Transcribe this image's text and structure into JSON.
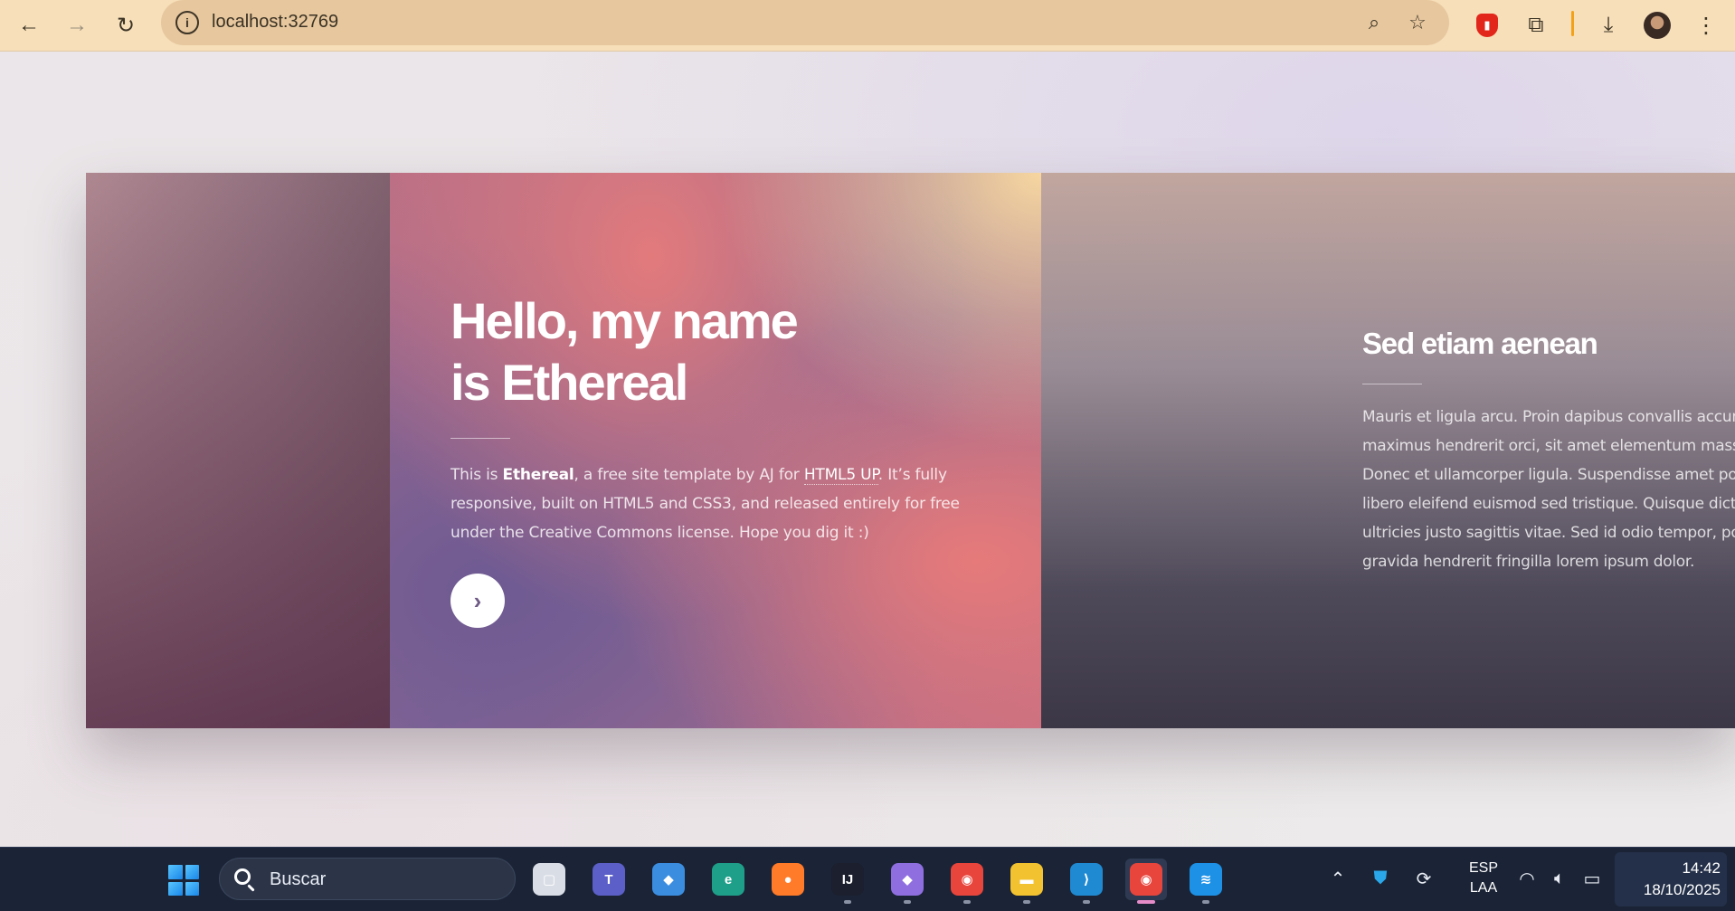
{
  "browser": {
    "url": "localhost:32769",
    "site_info_glyph": "i",
    "back_icon": "arrow-left-icon",
    "forward_icon": "arrow-right-icon",
    "reload_icon": "reload-icon",
    "zoom_icon": "zoom-out-icon",
    "bookmark_icon": "star-icon",
    "extensions": [
      "ublock-icon",
      "puzzle-icon"
    ],
    "download_icon": "download-icon",
    "menu_icon": "kebab-menu-icon"
  },
  "intro": {
    "title_line1": "Hello, my name",
    "title_line2": "is Ethereal",
    "text_prefix": "This is ",
    "text_brand": "Ethereal",
    "text_middle": ", a free site template by AJ for ",
    "text_link": "HTML5 UP",
    "text_suffix": ". It’s fully responsive, built on HTML5 and CSS3, and released entirely for free under the Creative Commons license. Hope you dig it :)",
    "next_glyph": "›"
  },
  "section": {
    "title": "Sed etiam aenean",
    "lines": [
      "Mauris et ligula arcu. Proin dapibus convallis accumsa",
      "maximus hendrerit orci, sit amet elementum massa h",
      "Donec et ullamcorper ligula. Suspendisse amet poten",
      "libero eleifend euismod sed tristique. Quisque dictum",
      "ultricies justo sagittis vitae. Sed id odio tempor, portti",
      "gravida hendrerit fringilla lorem ipsum dolor."
    ]
  },
  "taskbar": {
    "search_placeholder": "Buscar",
    "apps": [
      {
        "name": "task-view",
        "glyph": "▢",
        "color": "#d9dde6"
      },
      {
        "name": "teams",
        "glyph": "T",
        "color": "#5b5fc7"
      },
      {
        "name": "copilot",
        "glyph": "◆",
        "color": "#3b8de0"
      },
      {
        "name": "edge",
        "glyph": "e",
        "color": "#1e9f8a"
      },
      {
        "name": "firefox",
        "glyph": "●",
        "color": "#ff7a29"
      },
      {
        "name": "intellij",
        "glyph": "IJ",
        "color": "#1b1f2e"
      },
      {
        "name": "obsidian",
        "glyph": "◆",
        "color": "#8f6fe0"
      },
      {
        "name": "chrome-profile",
        "glyph": "◉",
        "color": "#e8453c"
      },
      {
        "name": "file-explorer",
        "glyph": "▬",
        "color": "#f2c230"
      },
      {
        "name": "vscode",
        "glyph": "⟩",
        "color": "#1f8ad2"
      },
      {
        "name": "chrome-active",
        "glyph": "◉",
        "color": "#e8453c"
      },
      {
        "name": "docker",
        "glyph": "≋",
        "color": "#1d91e6"
      }
    ],
    "language_line1": "ESP",
    "language_line2": "LAA",
    "time": "14:42",
    "date": "18/10/2025"
  }
}
